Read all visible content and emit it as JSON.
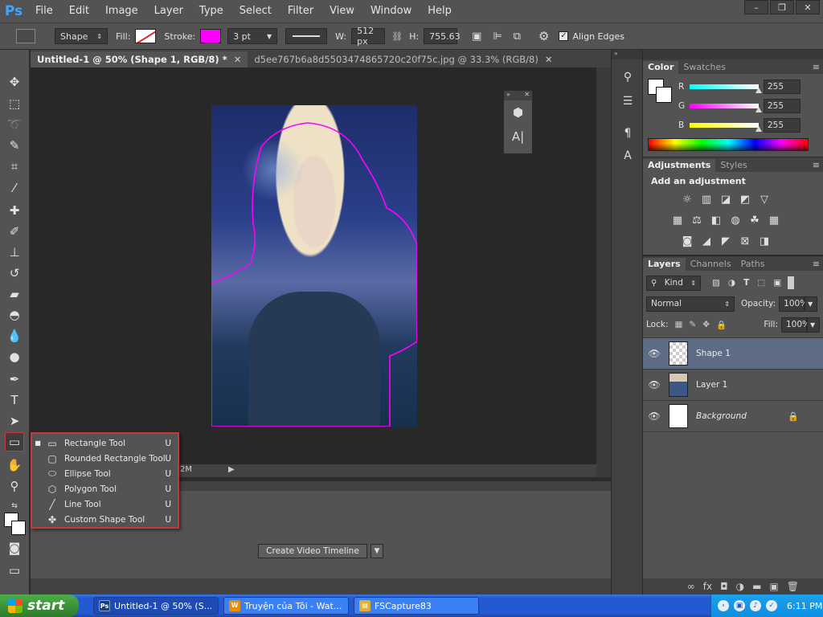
{
  "app": {
    "logo": "Ps"
  },
  "menu": [
    "File",
    "Edit",
    "Image",
    "Layer",
    "Type",
    "Select",
    "Filter",
    "View",
    "Window",
    "Help"
  ],
  "window_controls": [
    "–",
    "❐",
    "✕"
  ],
  "options_bar": {
    "mode": "Shape",
    "fill_label": "Fill:",
    "stroke_label": "Stroke:",
    "stroke_color": "#ff00ff",
    "stroke_width": "3 pt",
    "w_label": "W:",
    "width": "512 px",
    "h_label": "H:",
    "height": "755.63",
    "align_edges": "Align Edges"
  },
  "tabs": [
    {
      "label": "Untitled-1 @ 50% (Shape 1, RGB/8) *",
      "close": "✕"
    },
    {
      "label": "d5ee767b6a8d5503474865720c20f75c.jpg @ 33.3% (RGB/8)",
      "close": "✕"
    }
  ],
  "status": {
    "doc_size": "2M",
    "arrow": "▶"
  },
  "shape_flyout": [
    {
      "label": "Rectangle Tool",
      "shortcut": "U",
      "icon": "rectangle-icon",
      "glyph": "▭",
      "selected": "■"
    },
    {
      "label": "Rounded Rectangle Tool",
      "shortcut": "U",
      "icon": "rounded-rectangle-icon",
      "glyph": "▢",
      "selected": ""
    },
    {
      "label": "Ellipse Tool",
      "shortcut": "U",
      "icon": "ellipse-icon",
      "glyph": "⬭",
      "selected": ""
    },
    {
      "label": "Polygon Tool",
      "shortcut": "U",
      "icon": "polygon-icon",
      "glyph": "⬡",
      "selected": ""
    },
    {
      "label": "Line Tool",
      "shortcut": "U",
      "icon": "line-icon",
      "glyph": "╱",
      "selected": ""
    },
    {
      "label": "Custom Shape Tool",
      "shortcut": "U",
      "icon": "custom-shape-icon",
      "glyph": "✤",
      "selected": ""
    }
  ],
  "timeline": {
    "create_button": "Create Video Timeline",
    "dropdown": "▼"
  },
  "color_panel": {
    "tabs": [
      "Color",
      "Swatches"
    ],
    "channels": [
      {
        "label": "R",
        "value": "255",
        "gradient": "linear-gradient(90deg,#00ffff,#ffffff)"
      },
      {
        "label": "G",
        "value": "255",
        "gradient": "linear-gradient(90deg,#ff00ff,#ffffff)"
      },
      {
        "label": "B",
        "value": "255",
        "gradient": "linear-gradient(90deg,#ffff00,#ffffff)"
      }
    ]
  },
  "adjustments_panel": {
    "tabs": [
      "Adjustments",
      "Styles"
    ],
    "title": "Add an adjustment",
    "row1": [
      "☼",
      "▥",
      "◪",
      "◩",
      "▽"
    ],
    "row2": [
      "▦",
      "⚖",
      "◧",
      "◍",
      "☘",
      "▦"
    ],
    "row3": [
      "◙",
      "◢",
      "◤",
      "⊠",
      "◨"
    ]
  },
  "layers_panel": {
    "tabs": [
      "Layers",
      "Channels",
      "Paths"
    ],
    "filter": "Kind",
    "blend_mode": "Normal",
    "opacity_label": "Opacity:",
    "opacity": "100%",
    "lock_label": "Lock:",
    "fill_label": "Fill:",
    "fill": "100%",
    "layers": [
      {
        "name": "Shape 1",
        "thumb": "checker"
      },
      {
        "name": "Layer 1",
        "thumb": "photo"
      },
      {
        "name": "Background",
        "thumb": "white",
        "locked": "🔒"
      }
    ],
    "footer": [
      "∞",
      "fx",
      "◘",
      "◑",
      "▬",
      "▣",
      "🗑"
    ]
  },
  "taskbar": {
    "start": "start",
    "items": [
      {
        "label": "Untitled-1 @ 50% (S...",
        "icon": "Ps",
        "icon_color": "#1a3a8a"
      },
      {
        "label": "Truyện của Tôi - Wat...",
        "icon": "W",
        "icon_color": "#f08a00"
      },
      {
        "label": "FSCapture83",
        "icon": "▤",
        "icon_color": "#e0b030"
      }
    ],
    "clock": "6:11 PM"
  }
}
